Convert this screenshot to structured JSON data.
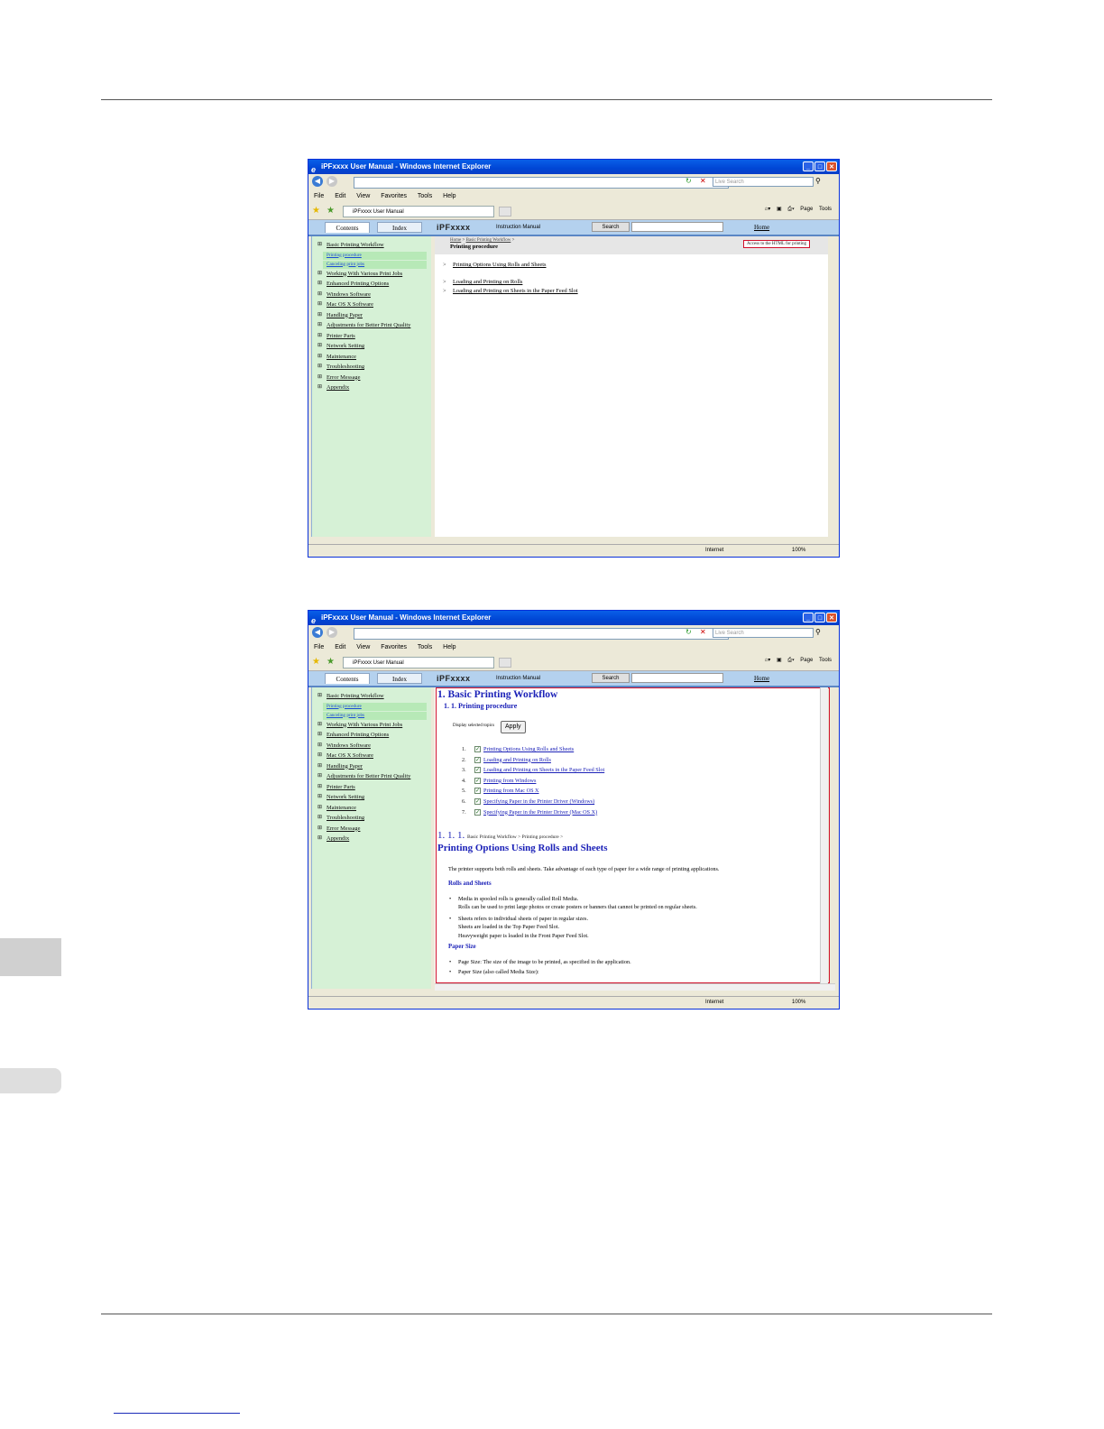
{
  "window": {
    "title": "iPFxxxx User Manual - Windows Internet Explorer",
    "search_placeholder": "Live Search",
    "menu": [
      "File",
      "Edit",
      "View",
      "Favorites",
      "Tools",
      "Help"
    ],
    "tab_label": "iPFxxxx User Manual",
    "cmd_page": "Page",
    "cmd_tools": "Tools",
    "status_zone": "Internet",
    "status_zoom": "100%"
  },
  "manual": {
    "tab_contents": "Contents",
    "tab_index": "Index",
    "brand": "iPFxxxx",
    "subtitle": "Instruction Manual",
    "search_button": "Search",
    "home": "Home"
  },
  "toc": [
    {
      "label": "Basic Printing Workflow",
      "sub": false
    },
    {
      "label": "Printing procedure",
      "sub": true
    },
    {
      "label": "Canceling print jobs",
      "sub": true
    },
    {
      "label": "Working With Various Print Jobs",
      "sub": false
    },
    {
      "label": "Enhanced Printing Options",
      "sub": false
    },
    {
      "label": "Windows Software",
      "sub": false
    },
    {
      "label": "Mac OS X Software",
      "sub": false
    },
    {
      "label": "Handling Paper",
      "sub": false
    },
    {
      "label": "Adjustments for Better Print Quality",
      "sub": false
    },
    {
      "label": "Printer Parts",
      "sub": false
    },
    {
      "label": "Network Setting",
      "sub": false
    },
    {
      "label": "Maintenance",
      "sub": false
    },
    {
      "label": "Troubleshooting",
      "sub": false
    },
    {
      "label": "Error Message",
      "sub": false
    },
    {
      "label": "Appendix",
      "sub": false
    }
  ],
  "page1": {
    "crumb_home": "Home",
    "crumb_sep": ">",
    "crumb_section": "Basic Printing Workflow",
    "crumb_tail": ">",
    "title": "Printing procedure",
    "print_button": "Access to the HTML for printing",
    "links": [
      "Printing Options Using Rolls and Sheets",
      "Loading and Printing on Rolls",
      "Loading and Printing on Sheets in the Paper Feed Slot"
    ]
  },
  "page2": {
    "h1": "1. Basic Printing Workflow",
    "h2": "1. 1. Printing procedure",
    "display_label": "Display selected topics",
    "apply": "Apply",
    "topics": [
      {
        "n": "1.",
        "label": "Printing Options Using Rolls and Sheets"
      },
      {
        "n": "2.",
        "label": "Loading and Printing on Rolls"
      },
      {
        "n": "3.",
        "label": "Loading and Printing on Sheets in the Paper Feed Slot"
      },
      {
        "n": "4.",
        "label": "Printing from Windows"
      },
      {
        "n": "5.",
        "label": "Printing from Mac OS X"
      },
      {
        "n": "6.",
        "label": "Specifying Paper in the Printer Driver (Windows)"
      },
      {
        "n": "7.",
        "label": "Specifying Paper in the Printer Driver (Mac OS X)"
      }
    ],
    "section_num": "1. 1. 1.",
    "section_crumbs": "Basic Printing Workflow > Printing procedure >",
    "section_title": "Printing Options Using Rolls and Sheets",
    "intro": "The printer supports both rolls and sheets. Take advantage of each type of paper for a wide range of printing applications.",
    "sub1": "Rolls and Sheets",
    "bullet1": [
      "Media in spooled rolls is generally called Roll Media.",
      "Rolls can be used to print large photos or create posters or banners that cannot be printed on regular sheets."
    ],
    "bullet2": [
      "Sheets refers to individual sheets of paper in regular sizes.",
      "Sheets are loaded in the Top Paper Feed Slot.",
      "Heavyweight paper is loaded in the Front Paper Feed Slot."
    ],
    "sub2": "Paper Size",
    "bullet3": "Page Size: The size of the image to be printed, as specified in the application.",
    "bullet4": "Paper Size (also called Media Size):"
  }
}
